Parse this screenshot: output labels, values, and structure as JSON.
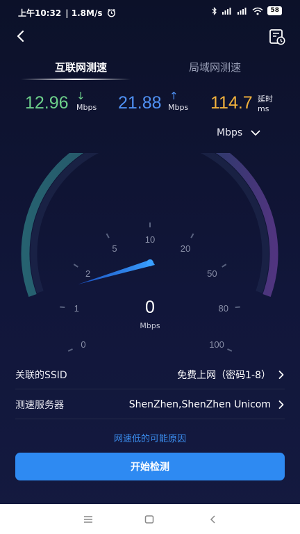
{
  "status_bar": {
    "time": "上午10:32",
    "speed": "| 1.8M/s",
    "battery": "58"
  },
  "tabs": [
    {
      "label": "互联网测速",
      "active": true
    },
    {
      "label": "局域网测速",
      "active": false
    }
  ],
  "metrics": {
    "download": {
      "value": "12.96",
      "unit": "Mbps",
      "arrow": "↓",
      "color": "#6dd08a"
    },
    "upload": {
      "value": "21.88",
      "unit": "Mbps",
      "arrow": "↑",
      "color": "#4f90f2"
    },
    "latency": {
      "value": "114.7",
      "unit_top": "延时",
      "unit": "ms",
      "color": "#f2b23c"
    }
  },
  "unit_selector": {
    "label": "Mbps"
  },
  "gauge": {
    "ticks": [
      "0",
      "1",
      "2",
      "5",
      "10",
      "20",
      "50",
      "80",
      "100"
    ],
    "current_speed": "0",
    "unit": "Mbps",
    "needle_color": "#2e8af2"
  },
  "rows": {
    "ssid": {
      "label": "关联的SSID",
      "value": "免费上网（密码1-8）"
    },
    "server": {
      "label": "测速服务器",
      "value": "ShenZhen,ShenZhen Unicom"
    }
  },
  "reason_link": "网速低的可能原因",
  "start_button": "开始检测",
  "icons": {
    "back": "back-arrow-icon",
    "history": "history-icon",
    "dropdown": "chevron-down-icon",
    "row_chevron": "chevron-right-icon"
  }
}
